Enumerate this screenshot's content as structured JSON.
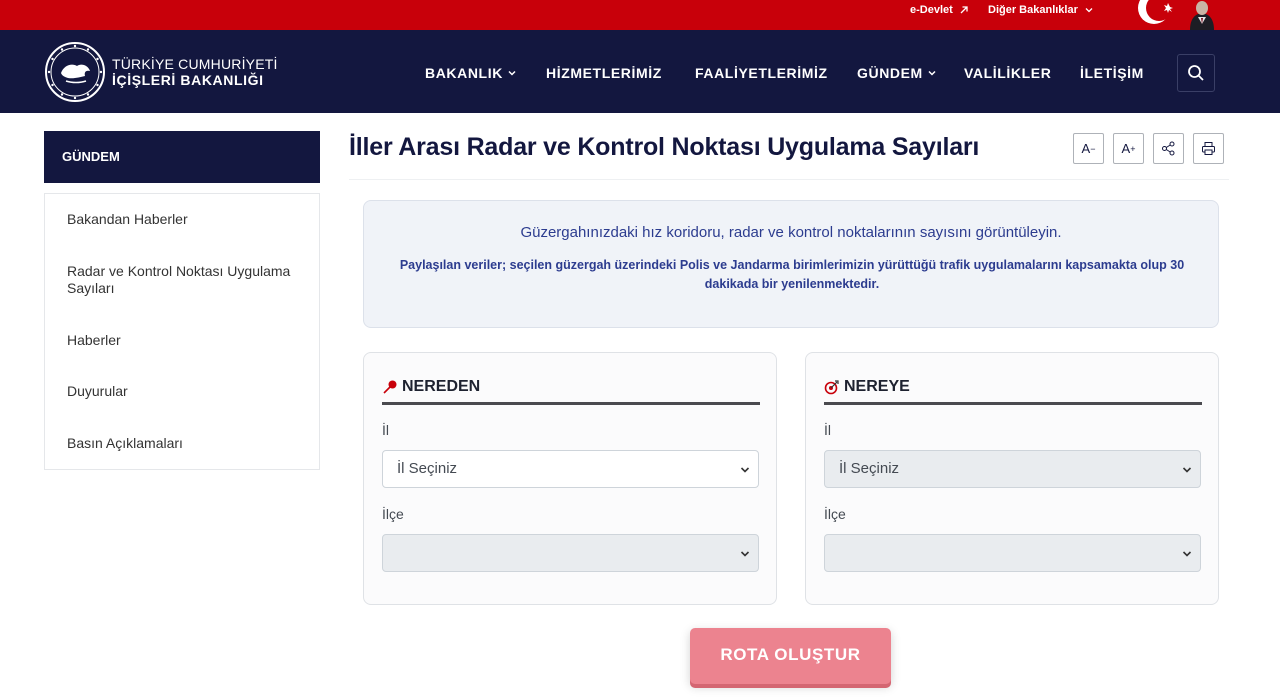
{
  "topbar": {
    "edevlet": "e-Devlet",
    "diger": "Diğer Bakanlıklar"
  },
  "header": {
    "logo_line1": "TÜRKİYE CUMHURİYETİ",
    "logo_line2": "İÇİŞLERİ BAKANLIĞI",
    "nav": [
      "BAKANLIK",
      "HİZMETLERİMİZ",
      "FAALİYETLERİMİZ",
      "GÜNDEM",
      "VALİLİKLER",
      "İLETİŞİM"
    ]
  },
  "sidebar": {
    "title": "GÜNDEM",
    "items": [
      "Bakandan Haberler",
      "Radar ve Kontrol Noktası Uygulama Sayıları",
      "Haberler",
      "Duyurular",
      "Basın Açıklamaları"
    ]
  },
  "main": {
    "title": "İller Arası Radar ve Kontrol Noktası Uygulama Sayıları",
    "tools": {
      "decrease": "A",
      "increase": "A"
    },
    "info_main": "Güzergahınızdaki hız koridoru, radar ve kontrol noktalarının sayısını görüntüleyin.",
    "info_sub": "Paylaşılan veriler; seçilen güzergah üzerindeki Polis ve Jandarma birimlerimizin yürüttüğü trafik uygulamalarını kapsamakta olup 30 dakikada bir yenilenmektedir.",
    "from": {
      "title": "NEREDEN",
      "il_label": "İl",
      "il_value": "İl Seçiniz",
      "ilce_label": "İlçe",
      "ilce_value": ""
    },
    "to": {
      "title": "NEREYE",
      "il_label": "İl",
      "il_value": "İl Seçiniz",
      "ilce_label": "İlçe",
      "ilce_value": ""
    },
    "route_button": "ROTA OLUŞTUR"
  },
  "colors": {
    "topbar": "#c8000a",
    "navbar": "#13173f",
    "route_button": "#ec838f",
    "info_text": "#2c3c8f"
  }
}
